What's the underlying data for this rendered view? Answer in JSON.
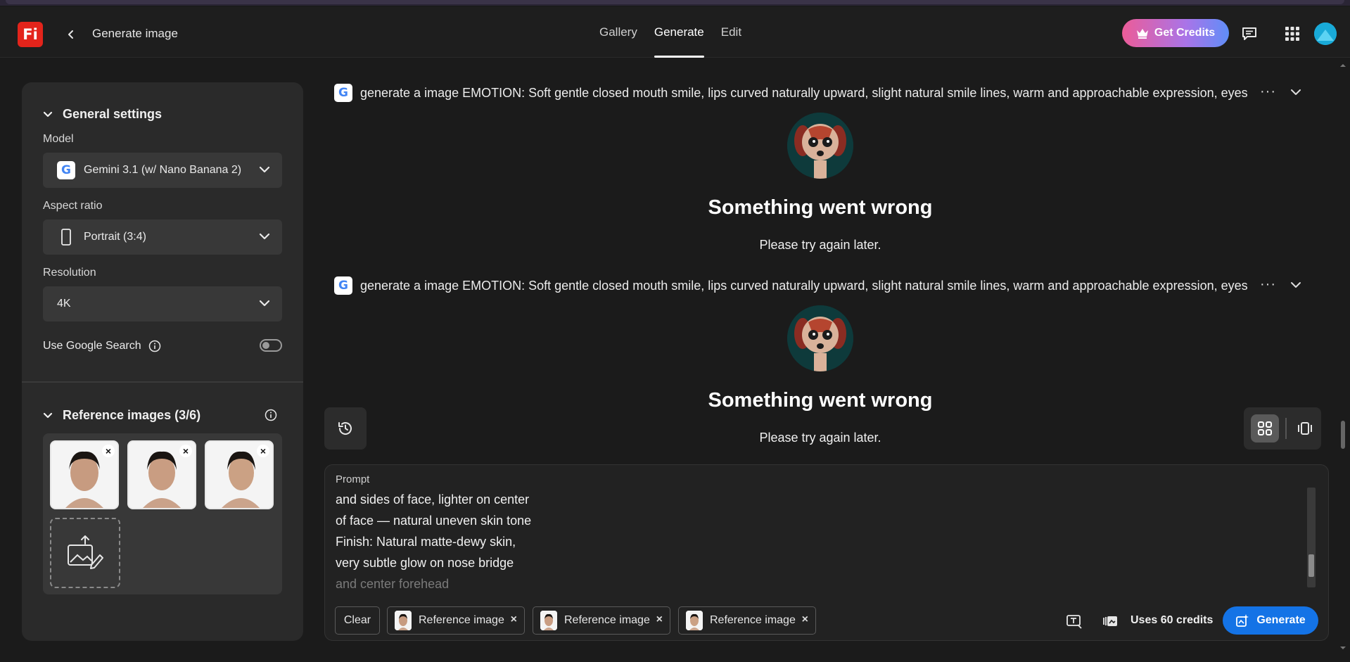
{
  "header": {
    "logo_text": "Fi",
    "title": "Generate image",
    "tabs": [
      {
        "label": "Gallery",
        "active": false
      },
      {
        "label": "Generate",
        "active": true
      },
      {
        "label": "Edit",
        "active": false
      }
    ],
    "credits_label": "Get Credits"
  },
  "sidebar": {
    "general_settings_title": "General settings",
    "model_label": "Model",
    "model_value": "Gemini 3.1 (w/ Nano Banana 2)",
    "model_icon_letter": "G",
    "aspect_label": "Aspect ratio",
    "aspect_value": "Portrait (3:4)",
    "resolution_label": "Resolution",
    "resolution_value": "4K",
    "google_search_label": "Use Google Search",
    "google_search_enabled": false,
    "reference_title": "Reference images (3/6)"
  },
  "feed": [
    {
      "icon_letter": "G",
      "prompt": "generate a image EMOTION: Soft gentle closed mouth smile, lips curved naturally upward, slight natural smile lines, warm and approachable expression, eyes",
      "more": "···",
      "error_title": "Something went wrong",
      "error_sub": "Please try again later."
    },
    {
      "icon_letter": "G",
      "prompt": "generate a image EMOTION: Soft gentle closed mouth smile, lips curved naturally upward, slight natural smile lines, warm and approachable expression, eyes",
      "more": "···",
      "error_title": "Something went wrong",
      "error_sub": "Please try again later."
    }
  ],
  "prompt_box": {
    "label": "Prompt",
    "lines": [
      "and sides of face, lighter on center",
      "of face — natural uneven skin tone",
      "Finish: Natural matte-dewy skin,",
      "very subtle glow on nose bridge",
      "and center forehead"
    ],
    "clear_label": "Clear",
    "chips": [
      "Reference image",
      "Reference image",
      "Reference image"
    ],
    "uses_label": "Uses 60 credits",
    "generate_label": "Generate"
  },
  "colors": {
    "accent_blue": "#1473e6",
    "logo_red": "#e3241b",
    "background": "#1b1b1b",
    "panel": "#2a2a2a"
  }
}
